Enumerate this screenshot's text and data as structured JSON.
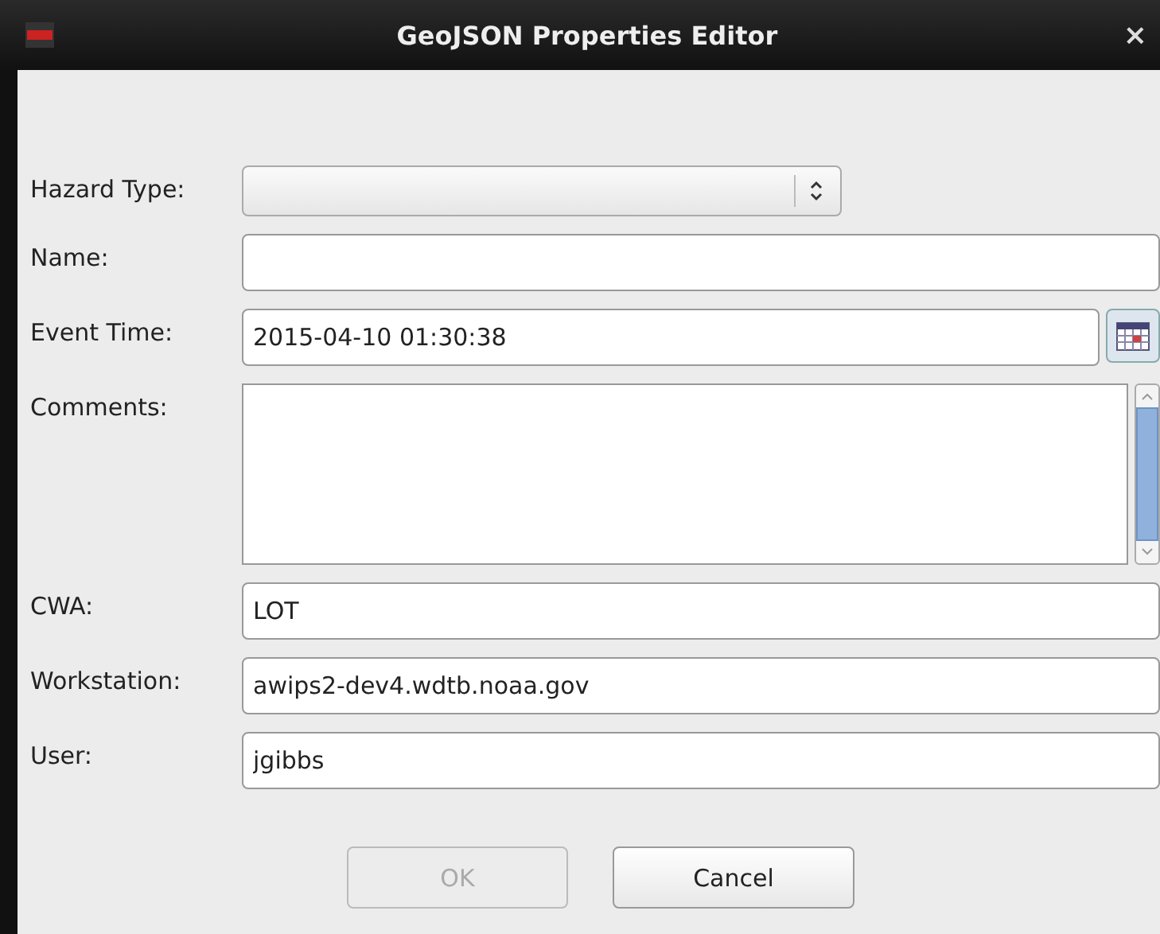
{
  "window": {
    "title": "GeoJSON Properties Editor",
    "close": "×"
  },
  "fields": [
    {
      "label": "Hazard Type:",
      "kind": "select"
    },
    {
      "label": "Name:",
      "kind": "text"
    },
    {
      "label": "Event Time:",
      "kind": "datetime",
      "value": "2015-04-10 01:30:38"
    },
    {
      "label": "Comments:",
      "kind": "textarea"
    },
    {
      "label": "CWA:",
      "kind": "text",
      "value": "LOT"
    },
    {
      "label": "Workstation:",
      "kind": "text",
      "value": "awips2-dev4.wdtb.noaa.gov"
    },
    {
      "label": "User:",
      "kind": "text",
      "value": "jgibbs"
    }
  ],
  "buttons": [
    {
      "label": "OK",
      "disabled": true
    },
    {
      "label": "Cancel",
      "disabled": false
    }
  ]
}
